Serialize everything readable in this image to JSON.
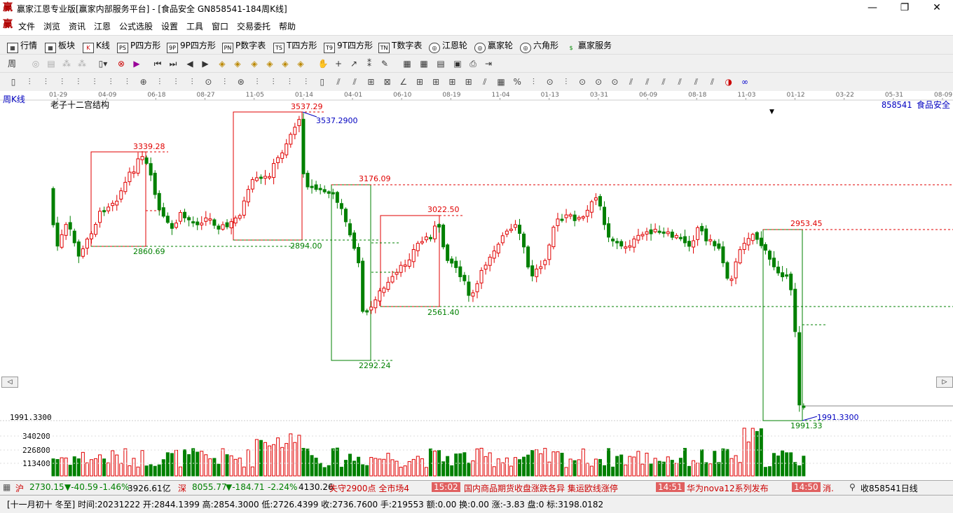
{
  "window": {
    "title": "赢家江恩专业版[赢家内部服务平台] - [食品安全   GN858541-184周K线]",
    "minimize": "—",
    "restore": "❐",
    "close": "✕"
  },
  "menu": [
    "文件",
    "浏览",
    "资讯",
    "江恩",
    "公式选股",
    "设置",
    "工具",
    "窗口",
    "交易委托",
    "帮助"
  ],
  "toolbar1": [
    {
      "icon": "▦",
      "label": "行情"
    },
    {
      "icon": "▦",
      "label": "板块"
    },
    {
      "icon": "K",
      "label": "K线"
    },
    {
      "icon": "PS",
      "label": "P四方形"
    },
    {
      "icon": "9P",
      "label": "9P四方形"
    },
    {
      "icon": "PN",
      "label": "P数字表"
    },
    {
      "icon": "TS",
      "label": "T四方形"
    },
    {
      "icon": "T9",
      "label": "9T四方形"
    },
    {
      "icon": "TN",
      "label": "T数字表"
    },
    {
      "icon": "◎",
      "label": "江恩轮"
    },
    {
      "icon": "◎",
      "label": "赢家轮"
    },
    {
      "icon": "◎",
      "label": "六角形"
    },
    {
      "icon": "$",
      "label": "赢家服务"
    }
  ],
  "chart": {
    "period_label": "周K线",
    "indicator_name": "老子十二宫结构",
    "code": "858541",
    "name": "食品安全",
    "date_axis": [
      "01-29",
      "04-09",
      "06-18",
      "08-27",
      "11-05",
      "01-14",
      "04-01",
      "06-10",
      "08-19",
      "11-04",
      "01-13",
      "03-31",
      "06-09",
      "08-18",
      "11-03",
      "01-12",
      "03-22",
      "05-31",
      "08-09"
    ],
    "price_labels": {
      "p3537a": "3537.29",
      "p3537b": "3537.2900",
      "p3339": "3339.28",
      "p3176": "3176.09",
      "p3022": "3022.50",
      "p2953": "2953.45",
      "p2894": "2894.00",
      "p2860": "2860.69",
      "p2561": "2561.40",
      "p2292": "2292.24",
      "p1991a": "1991.33",
      "p1991b": "1991.3300"
    },
    "left_axis": {
      "price": "1991.3300",
      "v1": "340200",
      "v2": "226800",
      "v3": "113400"
    }
  },
  "colors": {
    "up": "#e00000",
    "down": "#008000",
    "label_blue": "#0000c0"
  },
  "status": {
    "index1": "2730.15",
    "index1_change": "▼-40.59",
    "index1_pct": "-1.46%",
    "index1_amount": "3926.61亿",
    "index2": "8055.77",
    "index2_change": "▼-184.71",
    "index2_pct": "-2.24%",
    "index2_amount": "4130.26",
    "news1": "失守2900点 全市场4",
    "news1_time": "15:02",
    "news2": "国内商品期货收盘涨跌各异 集运欧线涨停",
    "news2_time": "14:51",
    "news3": "华为nova12系列发布",
    "news3_time": "14:50",
    "news4": "消.",
    "right": "收858541日线"
  },
  "info": "[十一月初十 冬至] 时间:20231222 开:2844.1399 高:2854.3000 低:2726.4399 收:2736.7600 手:219553 额:0.00 换:0.00 涨:-3.83 盘:0 标:3198.0182"
}
